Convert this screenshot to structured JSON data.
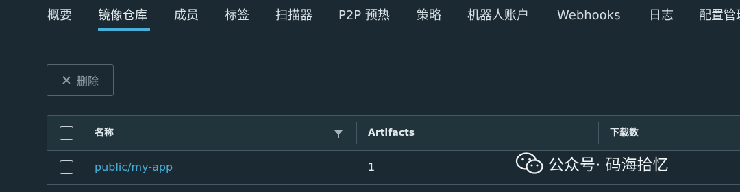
{
  "tabs": [
    {
      "label": "概要"
    },
    {
      "label": "镜像仓库"
    },
    {
      "label": "成员"
    },
    {
      "label": "标签"
    },
    {
      "label": "扫描器"
    },
    {
      "label": "P2P 预热"
    },
    {
      "label": "策略"
    },
    {
      "label": "机器人账户"
    },
    {
      "label": "Webhooks"
    },
    {
      "label": "日志"
    },
    {
      "label": "配置管理"
    }
  ],
  "active_tab": "镜像仓库",
  "toolbar": {
    "delete_label": "删除"
  },
  "table": {
    "columns": [
      {
        "label": "名称"
      },
      {
        "label": "Artifacts"
      },
      {
        "label": "下载数"
      }
    ],
    "rows": [
      {
        "name": "public/my-app",
        "artifacts": "1",
        "downloads": ""
      }
    ]
  },
  "watermark": {
    "text": "公众号· 码海拾忆"
  },
  "colors": {
    "background": "#1b2a32",
    "accent": "#49afd9",
    "border": "#485862"
  }
}
